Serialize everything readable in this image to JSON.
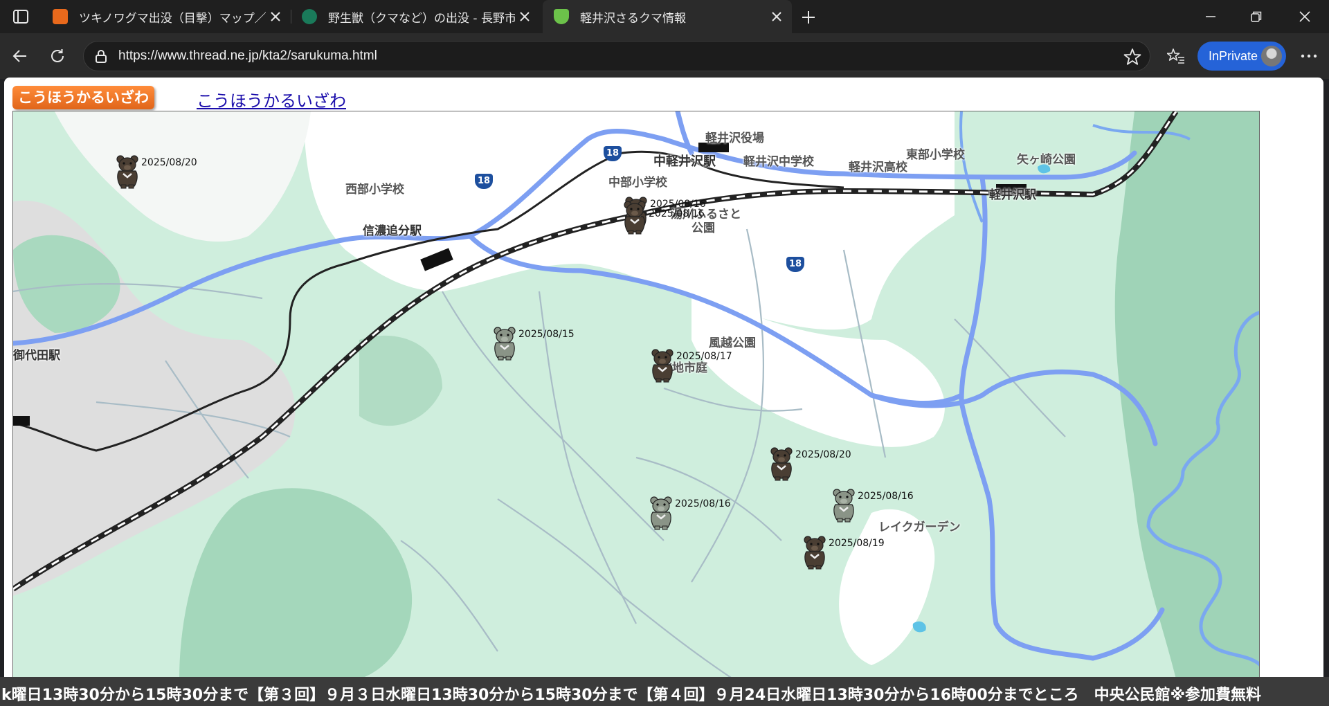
{
  "browser": {
    "tabs": [
      {
        "title": "ツキノワグマ出没（目撃）マップ／長野",
        "favicon_color": "#e8691c"
      },
      {
        "title": "野生獣（クマなど）の出没 - 長野市",
        "favicon_color": "#1a7a5a"
      },
      {
        "title": "軽井沢さるクマ情報",
        "favicon_color": "#6cc24a"
      }
    ],
    "url": "https://www.thread.ne.jp/kta2/sarukuma.html",
    "inprivate_label": "InPrivate"
  },
  "page": {
    "badge": "こうほうかるいざわ",
    "link": "こうほうかるいざわ",
    "ticker": "k曜日13時30分から15時30分まで【第３回】９月３日水曜日13時30分から15時30分まで【第４回】９月24日水曜日13時30分から16時00分までところ　中央公民館※参加費無料"
  },
  "map": {
    "labels": {
      "yakuba": "軽井沢役場",
      "naka_sta": "中軽井沢駅",
      "karuizawa_chu": "軽井沢中学校",
      "tobu": "東部小学校",
      "yagasaki": "矢ヶ崎公園",
      "karuizawa_ko": "軽井沢高校",
      "karuizawa_sta": "軽井沢駅",
      "seibu": "西部小学校",
      "chubu": "中部小学校",
      "yukawa": "湯川ふるさと",
      "yukawa2": "公園",
      "shinano": "信濃追分駅",
      "mitsuda": "御代田駅",
      "fuetsu": "風越公園",
      "hacchi": "発地市庭",
      "lake": "レイクガーデン",
      "r18a": "18",
      "r18b": "18",
      "r18c": "18"
    },
    "sightings": [
      {
        "date": "2025/08/20",
        "tone": "dark"
      },
      {
        "date": "2025/08/16",
        "tone": "dark"
      },
      {
        "date": "2025/08/16",
        "tone": "dark"
      },
      {
        "date": "2025/08/15",
        "tone": "light"
      },
      {
        "date": "2025/08/17",
        "tone": "dark"
      },
      {
        "date": "2025/08/20",
        "tone": "dark"
      },
      {
        "date": "2025/08/16",
        "tone": "light"
      },
      {
        "date": "2025/08/16",
        "tone": "light"
      },
      {
        "date": "2025/08/19",
        "tone": "dark"
      }
    ]
  }
}
